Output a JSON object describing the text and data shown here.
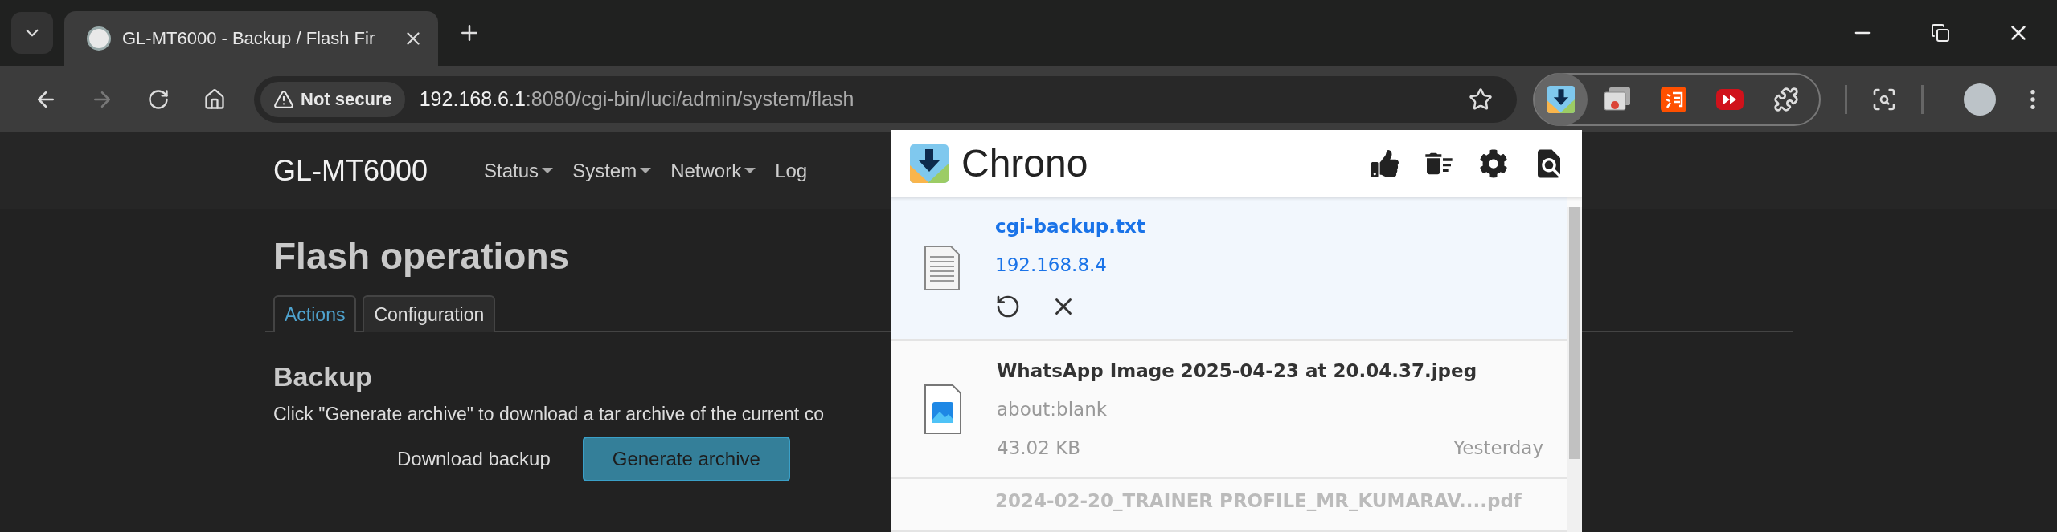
{
  "browser": {
    "tabs": [
      {
        "title": "GL-MT6000 - Backup / Flash Fir",
        "selected": true
      }
    ],
    "address": {
      "security": "Not secure",
      "host": "192.168.6.1",
      "path": ":8080/cgi-bin/luci/admin/system/flash"
    },
    "extensions": [
      {
        "kind": "chrono",
        "selected": true
      },
      {
        "kind": "cast",
        "selected": false
      },
      {
        "kind": "taobao",
        "selected": false
      },
      {
        "kind": "video",
        "selected": false
      },
      {
        "kind": "puzzle",
        "selected": false
      }
    ]
  },
  "page": {
    "brand": "GL-MT6000",
    "nav": [
      {
        "label": "Status",
        "dropdown": true
      },
      {
        "label": "System",
        "dropdown": true
      },
      {
        "label": "Network",
        "dropdown": true
      },
      {
        "label": "Log",
        "dropdown": false
      }
    ],
    "title": "Flash operations",
    "tabs": [
      {
        "label": "Actions",
        "selected": true
      },
      {
        "label": "Configuration",
        "selected": false
      }
    ],
    "section": "Backup",
    "description": "Click \"Generate archive\" to download a tar archive of the current co",
    "download_label": "Download backup",
    "button": "Generate archive"
  },
  "popup": {
    "title": "Chrono",
    "downloads": [
      {
        "kind": "text",
        "name": "cgi-backup.txt",
        "source": "192.168.8.4",
        "selected": true,
        "missing": false
      },
      {
        "kind": "image",
        "name": "WhatsApp Image 2025-04-23 at 20.04.37.jpeg",
        "source": "about:blank",
        "size": "43.02 KB",
        "time": "Yesterday",
        "selected": false,
        "missing": false
      },
      {
        "name": "2024-02-20_TRAINER PROFILE_MR_KUMARAV....pdf",
        "selected": false,
        "missing": true
      }
    ]
  }
}
